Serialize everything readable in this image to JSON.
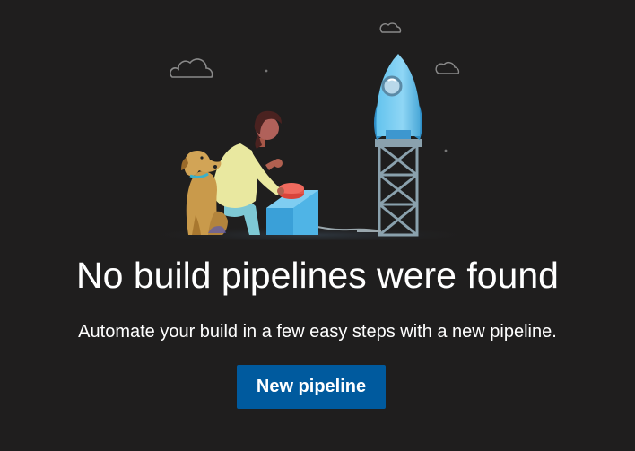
{
  "empty_state": {
    "title": "No build pipelines were found",
    "subtitle": "Automate your build in a few easy steps with a new pipeline.",
    "primary_button_label": "New pipeline"
  },
  "colors": {
    "background": "#1f1e1e",
    "button": "#005a9e",
    "text": "#ffffff"
  },
  "illustration": {
    "icons": [
      "cloud-icon",
      "rocket-icon",
      "tower-icon",
      "person-icon",
      "dog-icon",
      "launch-button-icon"
    ]
  }
}
